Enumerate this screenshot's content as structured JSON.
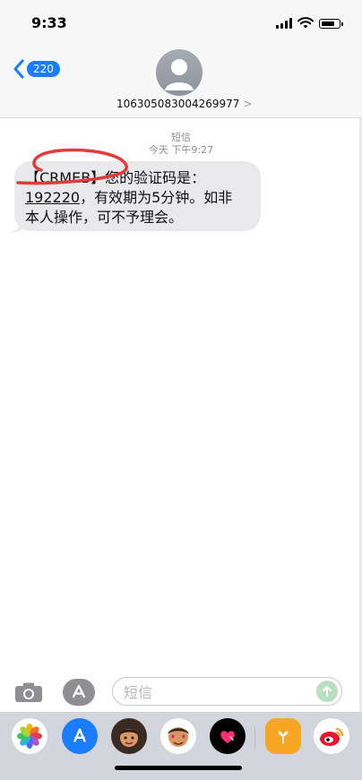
{
  "status_bar": {
    "time": "9:33"
  },
  "nav": {
    "back_badge": "220",
    "contact_name": "106305083004269977",
    "contact_chevron": ">"
  },
  "conversation": {
    "message_type": "短信",
    "timestamp": "今天 下午9:27",
    "message": {
      "line1": "【CRMEB】您的验证码是：",
      "otp": "192220",
      "line2_rest": "，有效期为5分钟。如非",
      "line3": "本人操作，可不予理会。"
    }
  },
  "composer": {
    "placeholder": "短信"
  },
  "colors": {
    "accent_blue": "#1a7cff",
    "bubble_grey": "#e9e9eb",
    "annotation_red": "#e23b3b"
  },
  "app_drawer": {
    "icons": [
      "photos-icon",
      "app-store-icon",
      "memoji-icon",
      "memoji-hearts-icon",
      "digital-touch-heart-icon",
      "plant-app-icon",
      "weibo-icon"
    ]
  }
}
